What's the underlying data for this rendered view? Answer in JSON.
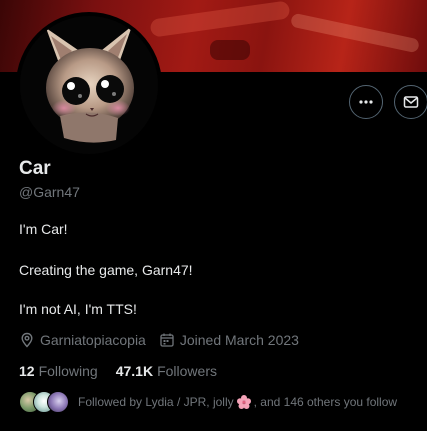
{
  "profile": {
    "name": "Car",
    "handle": "@Garn47",
    "bio": [
      "I'm Car!",
      "Creating the game, Garn47!",
      "I'm not AI, I'm TTS!"
    ],
    "location": "Garniatopiacopia",
    "joined": "Joined March 2023",
    "following_count": "12",
    "following_label": "Following",
    "followers_count": "47.1K",
    "followers_label": "Followers",
    "followed_by_prefix": "Followed by Lydia / JPR, jolly",
    "followed_by_suffix": ", and 146 others you follow"
  },
  "icons": {
    "more": "more-options-icon",
    "message": "mail-icon",
    "location": "location-pin-icon",
    "calendar": "calendar-icon",
    "flower": "cherry-blossom-emoji"
  },
  "colors": {
    "background": "#000000",
    "text_primary": "#e7e9ea",
    "text_secondary": "#71767b",
    "button_border": "#536471"
  }
}
